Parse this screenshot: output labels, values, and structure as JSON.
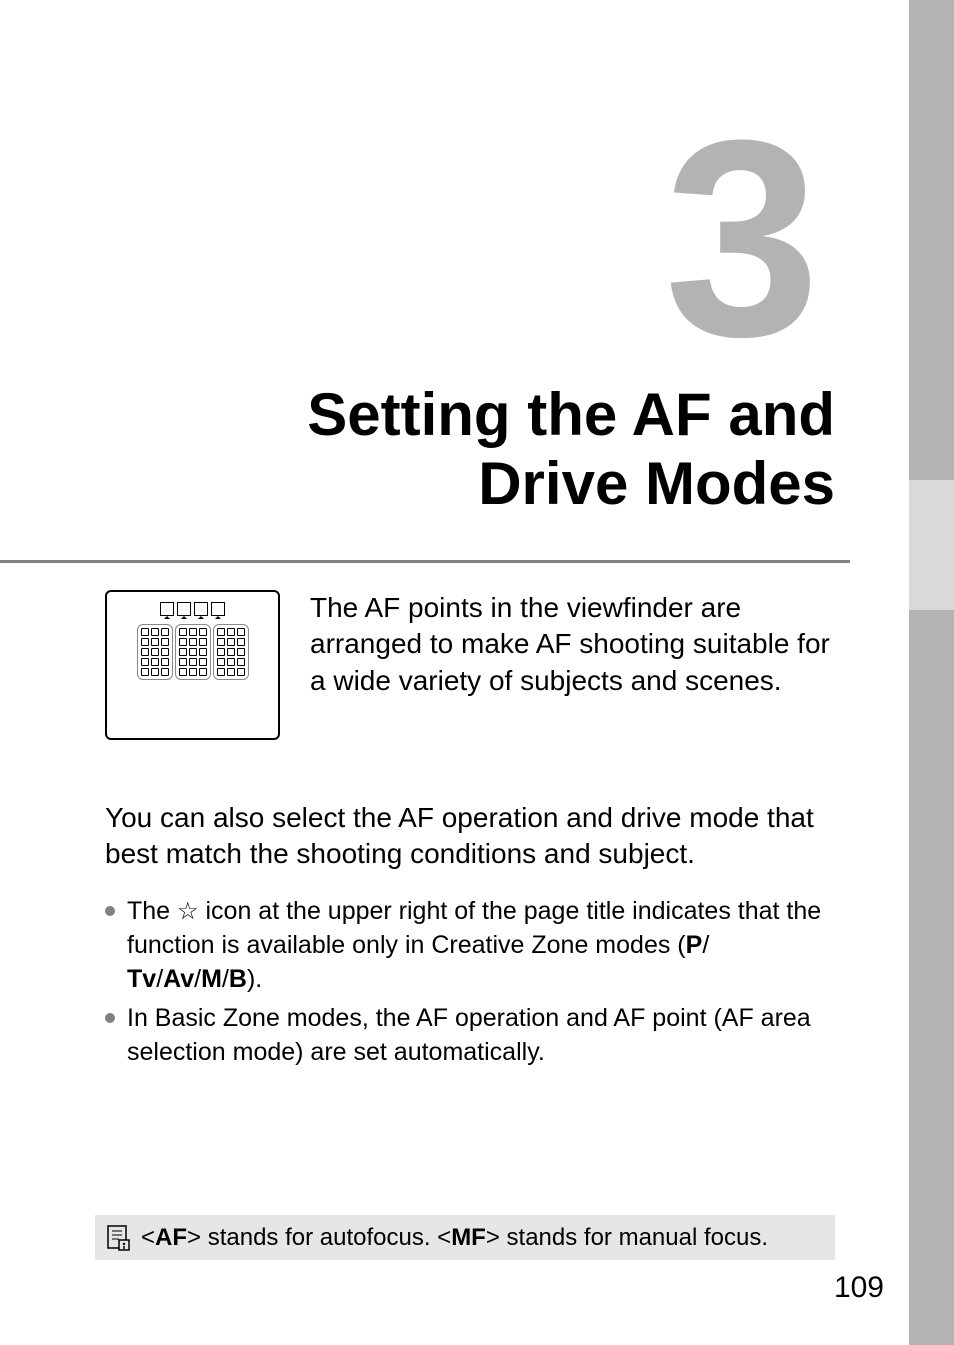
{
  "chapter": {
    "number": "3",
    "title_line1": "Setting the AF and",
    "title_line2": "Drive Modes"
  },
  "viewfinder_text": "The AF points in the viewfinder are arranged to make AF shooting suitable for a wide variety of subjects and scenes.",
  "body_text_1": "You can also select the AF operation and drive mode that best match the shooting conditions and subject.",
  "bullets": [
    {
      "parts": {
        "pre": "The ",
        "star": "☆",
        "mid": " icon at the upper right of the page title indicates that the function is available only in Creative Zone modes (",
        "p": "P",
        "sep1": "/",
        "tv": "Tv",
        "sep2": "/",
        "av": "Av",
        "sep3": "/",
        "m": "M",
        "sep4": "/",
        "b": "B",
        "end": ")."
      }
    },
    {
      "text": "In Basic Zone modes, the AF operation and AF point (AF area selection mode) are set automatically."
    }
  ],
  "note": {
    "pre": "<",
    "af": "AF",
    "mid1": "> stands for autofocus. <",
    "mf": "MF",
    "mid2": "> stands for manual focus."
  },
  "page_number": "109"
}
